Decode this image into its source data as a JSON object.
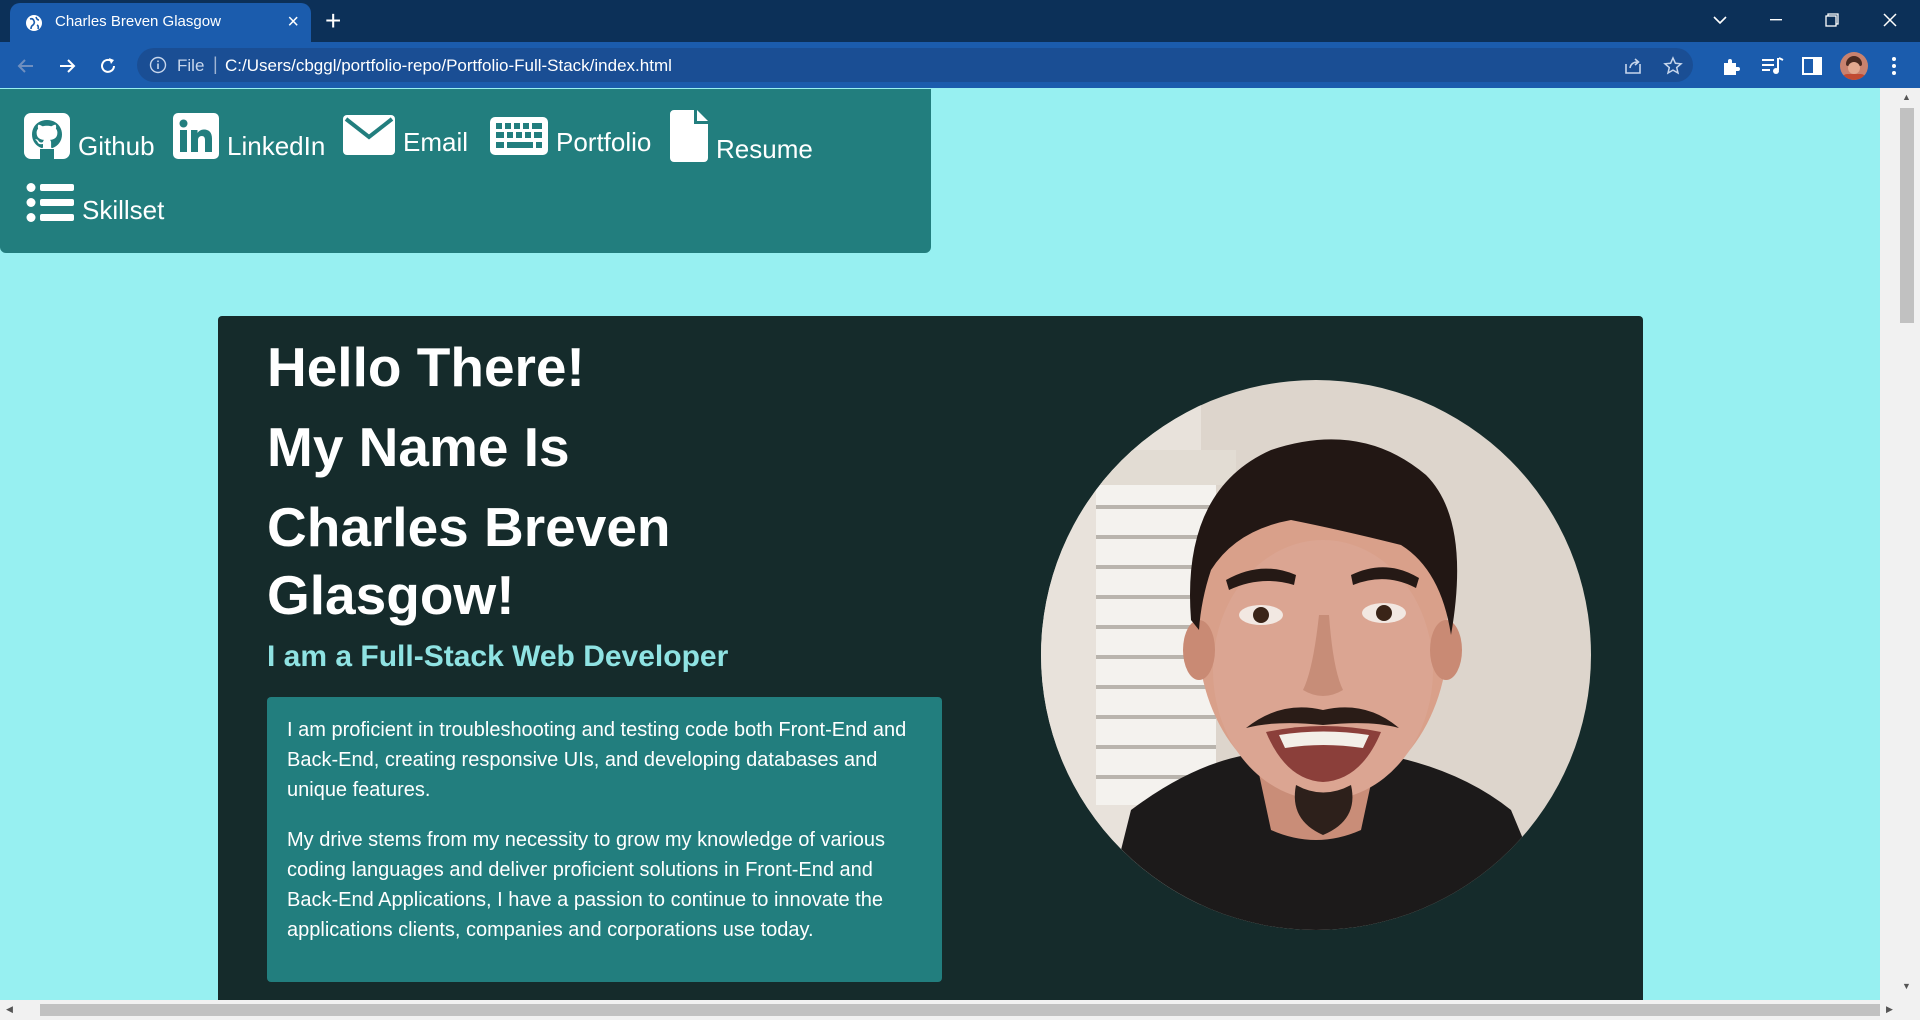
{
  "browser": {
    "tab_title": "Charles Breven Glasgow",
    "address_scheme_label": "File",
    "address_url": "C:/Users/cbggl/portfolio-repo/Portfolio-Full-Stack/index.html"
  },
  "nav": {
    "links": [
      {
        "label": "Github",
        "icon": "github-icon"
      },
      {
        "label": "LinkedIn",
        "icon": "linkedin-icon"
      },
      {
        "label": "Email",
        "icon": "envelope-icon"
      },
      {
        "label": "Portfolio",
        "icon": "keyboard-icon"
      },
      {
        "label": "Resume",
        "icon": "file-icon"
      },
      {
        "label": "Skillset",
        "icon": "list-icon"
      }
    ]
  },
  "hero": {
    "greeting": "Hello There!",
    "name_intro": "My Name Is",
    "name_line1": "Charles Breven",
    "name_line2": "Glasgow!",
    "subtitle": "I am a Full-Stack Web Developer",
    "about_p1": "I am proficient in troubleshooting and testing code both Front-End and Back-End, creating responsive UIs, and developing databases and unique features.",
    "about_p2": "My drive stems from my necessity to grow my knowledge of various coding languages and deliver proficient solutions in Front-End and Back-End Applications, I have a passion to continue to innovate the applications clients, companies and corporations use today."
  },
  "colors": {
    "page_bg": "#97f0f1",
    "panel_teal": "#227e7e",
    "hero_bg": "#152b2b",
    "accent_subtitle": "#8fe3e3",
    "chrome_dark": "#0c3058",
    "chrome_blue": "#1b5cad"
  }
}
